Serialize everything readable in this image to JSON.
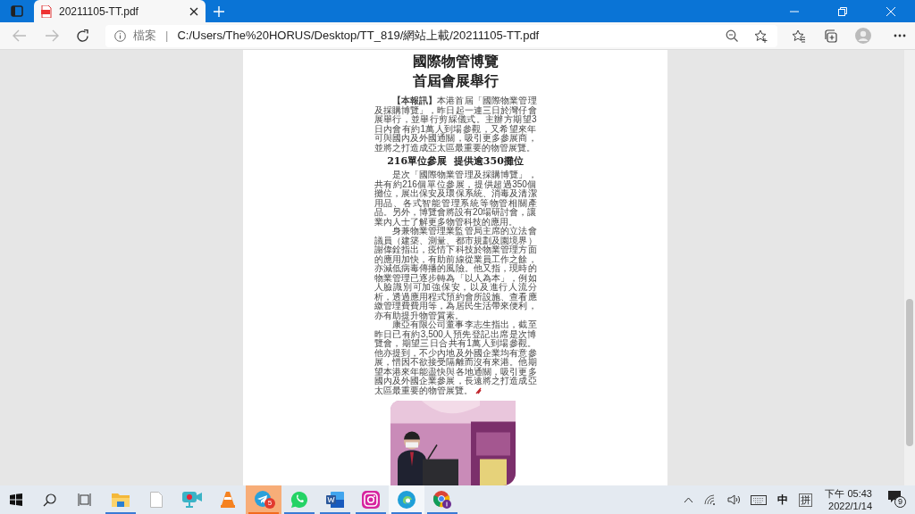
{
  "browser": {
    "tab": {
      "title": "20211105-TT.pdf",
      "selected": true
    },
    "address": {
      "label": "檔案",
      "separator": "|",
      "url": "C:/Users/The%20HORUS/Desktop/TT_819/網站上載/20211105-TT.pdf"
    }
  },
  "document": {
    "headline": [
      "國際物管博覽",
      "首屆會展舉行"
    ],
    "blocks": [
      {
        "kind": "paragraph",
        "text": "**【本報訊】**本港首屆「國際物業管理及採購博覽」，昨日起一連三日於灣仔會展舉行，並舉行剪綵儀式。主辦方期望3日內會有約1萬人到場參觀，又希望來年可與國內及外國通關，吸引更多參展商，並將之打造成亞太區最重要的物管展覽。"
      },
      {
        "kind": "subheading",
        "text": "216單位參展  提供逾350攤位"
      },
      {
        "kind": "paragraph",
        "text": "是次「國際物業管理及採購博覽」，共有約216個單位參展，提供超過350個攤位，展出保安及環保系統、消毒及清潔用品、各式智能管理系統等物管相關產品。另外，博覽會將設有20場研討會，讓業內人士了解更多物管科技的應用。"
      },
      {
        "kind": "paragraph",
        "text": "身兼物業管理業監管局主席的立法會議員（建築、測量、都市規劃及園境界）謝偉銓指出，疫情下科技於物業管理方面的應用加快，有助前線從業員工作之餘，亦減低病毒傳播的風險。他又指，現時的物業管理已逐步轉為「以人為本」，例如人臉識別可加強保安，以及進行人流分析，透過應用程式預約會所設施、查看應繳管理費費用等，為居民生活帶來便利，亦有助提升物管質素。"
      },
      {
        "kind": "paragraph",
        "text": "康亞有限公司董事李志生指出，截至昨日已有約3,500人預先登記出席是次博覽會，期望三日合共有1萬人到場參觀。他亦提到，不少內地及外國企業均有意參展，惜因不欲接受隔離而沒有來港。他期望本港來年能盡快與各地通關，吸引更多國內及外國企業參展，長遠將之打造成亞太區最重要的物管展覽。"
      }
    ]
  },
  "taskbar": {
    "apps": [
      {
        "kind": "explorer",
        "running": true,
        "active": false,
        "attention": false
      },
      {
        "kind": "document",
        "running": false,
        "active": false,
        "attention": false
      },
      {
        "kind": "recorder",
        "running": false,
        "active": false,
        "attention": false
      },
      {
        "kind": "cone",
        "running": false,
        "active": false,
        "attention": false
      },
      {
        "kind": "messenger",
        "running": true,
        "active": false,
        "attention": true,
        "badge": "5"
      },
      {
        "kind": "chat",
        "running": true,
        "active": false,
        "attention": false
      },
      {
        "kind": "word",
        "running": true,
        "active": false,
        "attention": false
      },
      {
        "kind": "camera",
        "running": true,
        "active": false,
        "attention": false
      },
      {
        "kind": "browser",
        "running": true,
        "active": true,
        "attention": false
      },
      {
        "kind": "chrome",
        "running": true,
        "active": false,
        "attention": false
      }
    ],
    "ime": "中",
    "ime_mode": "拼",
    "time": "下午 05:43",
    "date": "2022/1/14",
    "notifications": "9"
  }
}
